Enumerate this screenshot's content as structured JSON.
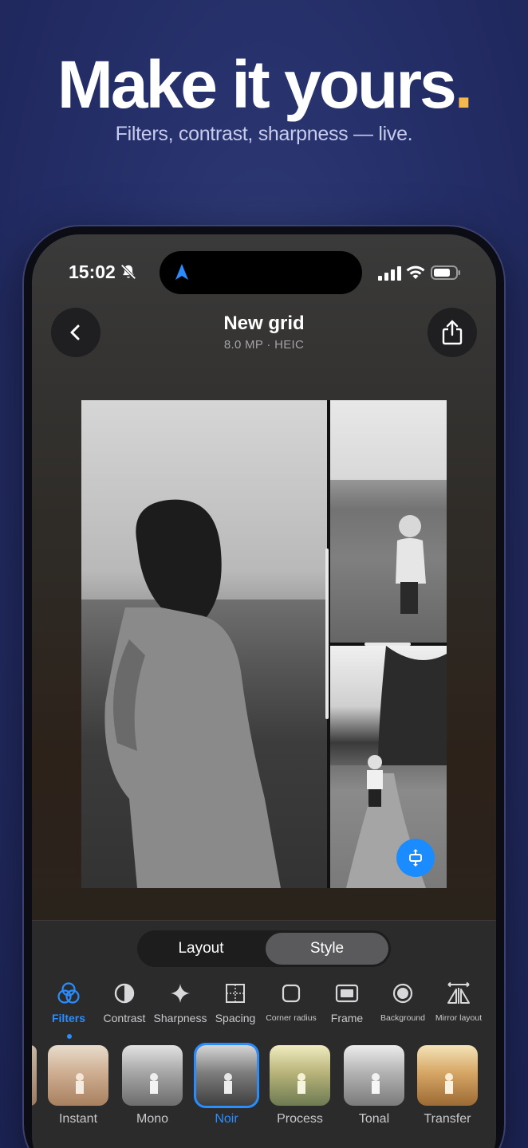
{
  "promo": {
    "headline": "Make it yours",
    "headline_dot": ".",
    "subline": "Filters, contrast, sharpness — live.",
    "accent_color": "#f2b84b"
  },
  "statusbar": {
    "time": "15:02",
    "silent_icon": "bell-slash-icon",
    "navigation_icon": "location-arrow-icon",
    "signal_icon": "cellular-signal-icon",
    "wifi_icon": "wifi-icon",
    "battery_icon": "battery-icon"
  },
  "header": {
    "back_icon": "chevron-left-icon",
    "title": "New grid",
    "meta": "8.0 MP · HEIC",
    "share_icon": "share-icon"
  },
  "canvas": {
    "cells": [
      "photo-large",
      "photo-top-right",
      "photo-bottom-right"
    ],
    "resize_icon": "resize-vertical-icon",
    "accent_color": "#1a8cff"
  },
  "segmented": {
    "options": [
      "Layout",
      "Style"
    ],
    "selected": "Style"
  },
  "tools": [
    {
      "label": "Filters",
      "icon": "filters-icon",
      "active": true
    },
    {
      "label": "Contrast",
      "icon": "contrast-icon",
      "active": false
    },
    {
      "label": "Sharpness",
      "icon": "sparkle-icon",
      "active": false
    },
    {
      "label": "Spacing",
      "icon": "spacing-icon",
      "active": false
    },
    {
      "label": "Corner radius",
      "icon": "corner-radius-icon",
      "active": false
    },
    {
      "label": "Frame",
      "icon": "frame-icon",
      "active": false
    },
    {
      "label": "Background",
      "icon": "background-icon",
      "active": false
    },
    {
      "label": "Mirror layout",
      "icon": "mirror-icon",
      "active": false
    }
  ],
  "filters": [
    {
      "label": "Instant",
      "active": false
    },
    {
      "label": "Mono",
      "active": false
    },
    {
      "label": "Noir",
      "active": true
    },
    {
      "label": "Process",
      "active": false
    },
    {
      "label": "Tonal",
      "active": false
    },
    {
      "label": "Transfer",
      "active": false
    }
  ],
  "colors": {
    "active_blue": "#2a8dff"
  }
}
